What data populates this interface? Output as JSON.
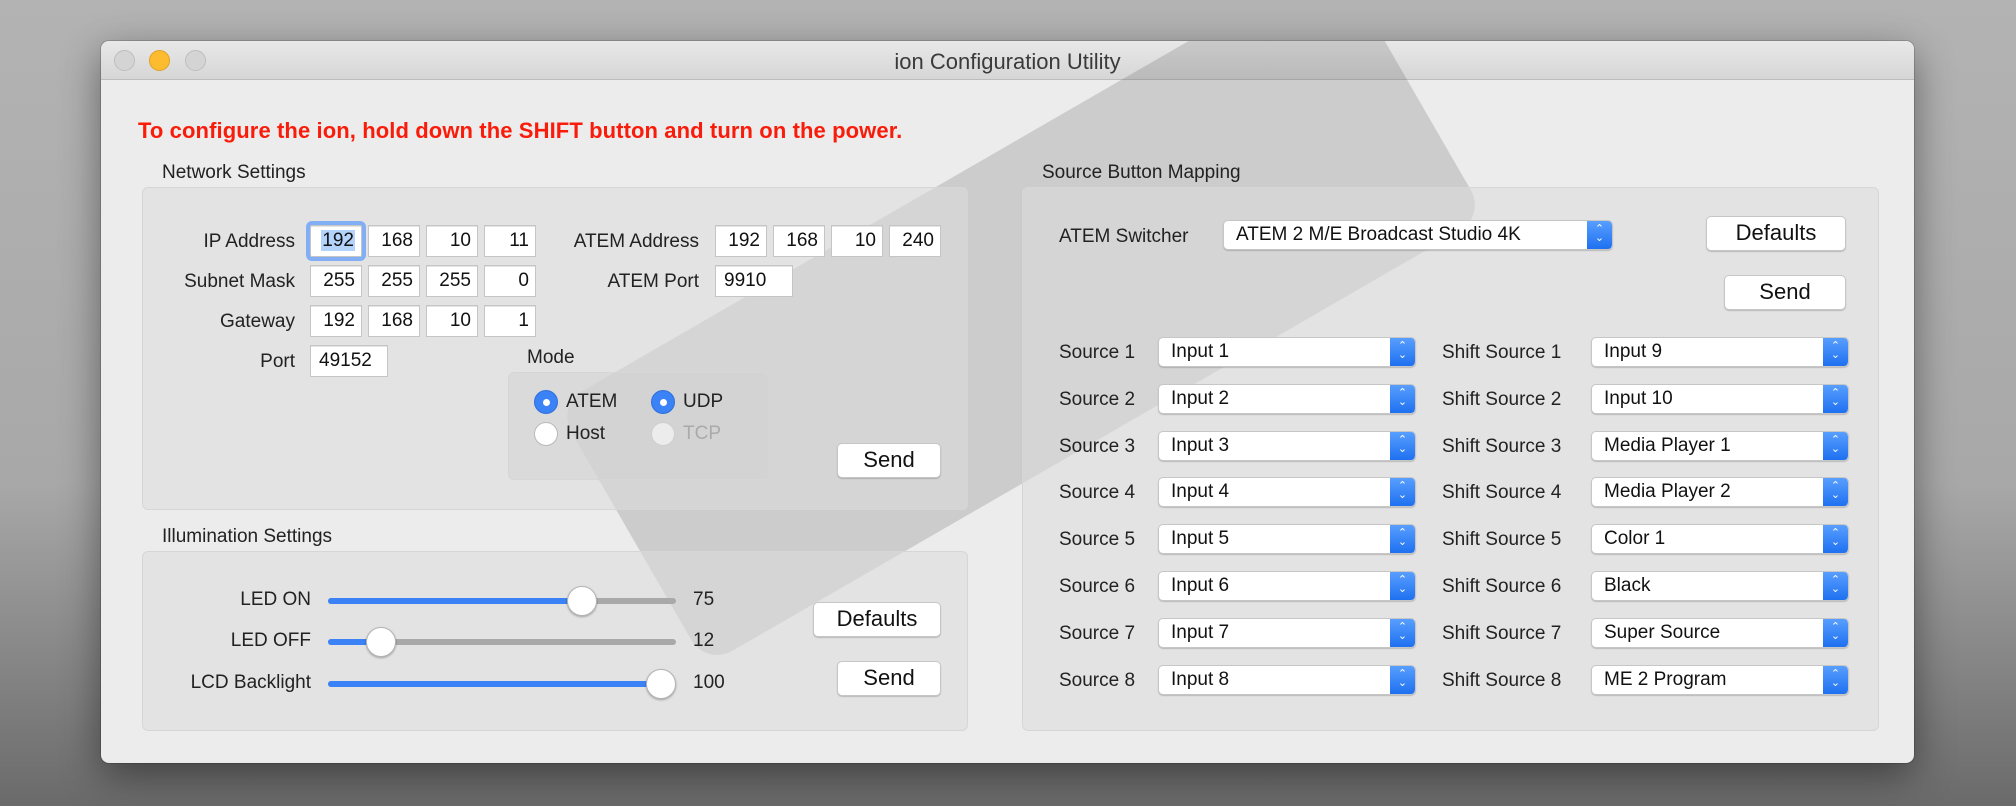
{
  "window": {
    "title": "ion Configuration Utility",
    "notice": "To configure the ion, hold down the SHIFT button and turn on the power.",
    "colors": {
      "notice": "#f91c0a",
      "accent": "#3b82f6",
      "minimize": "#fdbc2f"
    }
  },
  "network": {
    "title": "Network Settings",
    "ip_label": "IP Address",
    "ip": [
      "192",
      "168",
      "10",
      "11"
    ],
    "subnet_label": "Subnet Mask",
    "subnet": [
      "255",
      "255",
      "255",
      "0"
    ],
    "gateway_label": "Gateway",
    "gateway": [
      "192",
      "168",
      "10",
      "1"
    ],
    "port_label": "Port",
    "port": "49152",
    "atem_address_label": "ATEM Address",
    "atem_address": [
      "192",
      "168",
      "10",
      "240"
    ],
    "atem_port_label": "ATEM Port",
    "atem_port": "9910",
    "mode": {
      "title": "Mode",
      "options": [
        {
          "label": "ATEM",
          "selected": true,
          "disabled": false
        },
        {
          "label": "Host",
          "selected": false,
          "disabled": false
        },
        {
          "label": "UDP",
          "selected": true,
          "disabled": false
        },
        {
          "label": "TCP",
          "selected": false,
          "disabled": true
        }
      ]
    },
    "send_label": "Send"
  },
  "illumination": {
    "title": "Illumination Settings",
    "sliders": [
      {
        "label": "LED ON",
        "value": 75,
        "max": 100
      },
      {
        "label": "LED OFF",
        "value": 12,
        "max": 100
      },
      {
        "label": "LCD Backlight",
        "value": 100,
        "max": 100
      }
    ],
    "defaults_label": "Defaults",
    "send_label": "Send"
  },
  "mapping": {
    "title": "Source Button Mapping",
    "switcher_label": "ATEM Switcher",
    "switcher_value": "ATEM 2 M/E Broadcast Studio 4K",
    "defaults_label": "Defaults",
    "send_label": "Send",
    "sources": [
      {
        "label": "Source 1",
        "value": "Input 1"
      },
      {
        "label": "Source 2",
        "value": "Input 2"
      },
      {
        "label": "Source 3",
        "value": "Input 3"
      },
      {
        "label": "Source 4",
        "value": "Input 4"
      },
      {
        "label": "Source 5",
        "value": "Input 5"
      },
      {
        "label": "Source 6",
        "value": "Input 6"
      },
      {
        "label": "Source 7",
        "value": "Input 7"
      },
      {
        "label": "Source 8",
        "value": "Input 8"
      }
    ],
    "shift_sources": [
      {
        "label": "Shift Source 1",
        "value": "Input 9"
      },
      {
        "label": "Shift Source 2",
        "value": "Input 10"
      },
      {
        "label": "Shift Source 3",
        "value": "Media Player 1"
      },
      {
        "label": "Shift Source 4",
        "value": "Media Player 2"
      },
      {
        "label": "Shift Source 5",
        "value": "Color 1"
      },
      {
        "label": "Shift Source 6",
        "value": "Black"
      },
      {
        "label": "Shift Source 7",
        "value": "Super Source"
      },
      {
        "label": "Shift Source 8",
        "value": "ME 2 Program"
      }
    ]
  }
}
